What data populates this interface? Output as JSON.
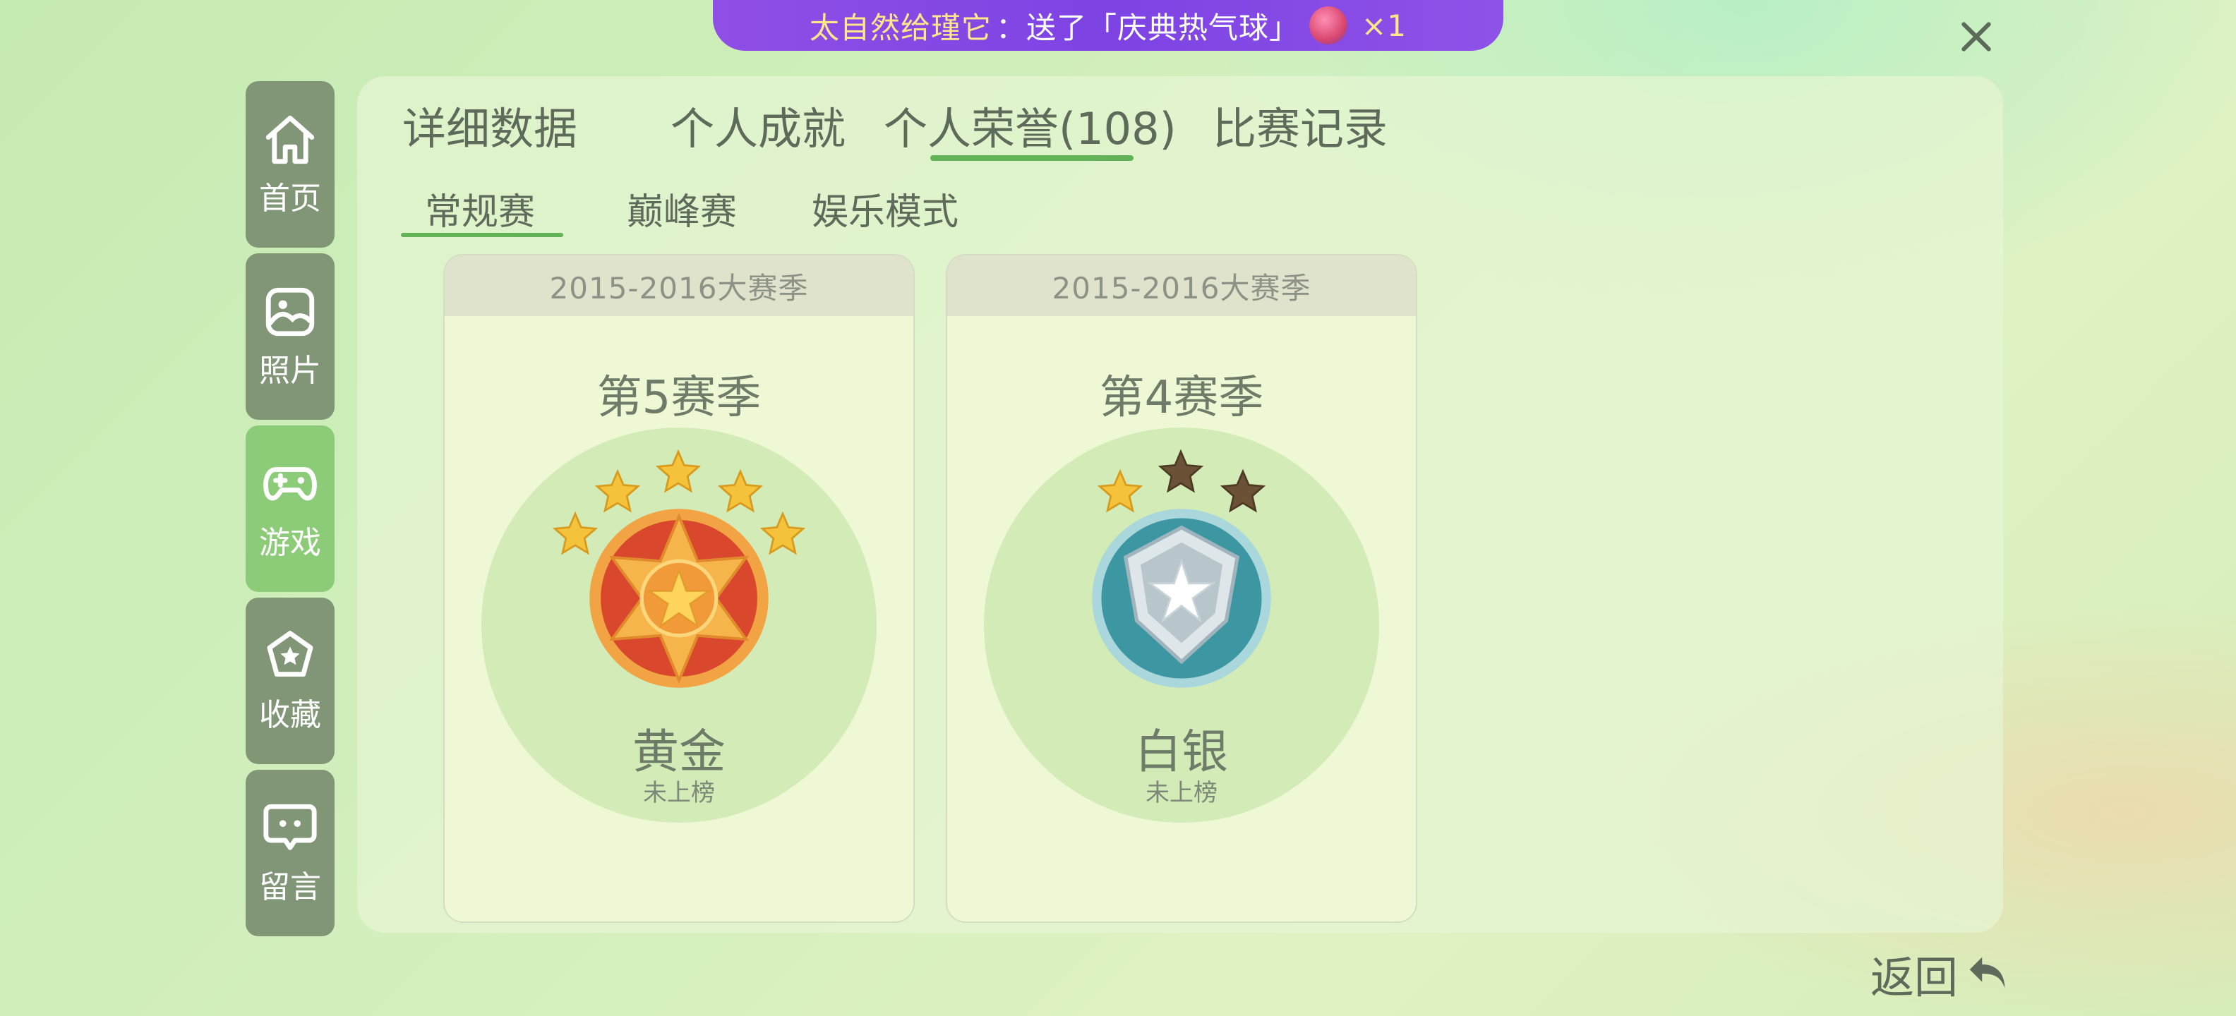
{
  "banner": {
    "user": "太自然给瑾它",
    "gift_text": "：送了「庆典热气球」",
    "count": "×1"
  },
  "sidebar": {
    "items": [
      {
        "label": "首页",
        "icon": "home-icon"
      },
      {
        "label": "照片",
        "icon": "photo-icon"
      },
      {
        "label": "游戏",
        "icon": "gamepad-icon"
      },
      {
        "label": "收藏",
        "icon": "star-collection-icon"
      },
      {
        "label": "留言",
        "icon": "message-icon"
      }
    ],
    "active": "游戏"
  },
  "tabs": {
    "detail": "详细数据",
    "achievements": "个人成就",
    "honors": "个人荣誉(108)",
    "records": "比赛记录",
    "active": "个人荣誉(108)"
  },
  "subtabs": {
    "regular": "常规赛",
    "peak": "巅峰赛",
    "casual": "娱乐模式",
    "active": "常规赛"
  },
  "cards": [
    {
      "season_range": "2015-2016大赛季",
      "season": "第5赛季",
      "rank": "黄金",
      "status": "未上榜",
      "stars_filled": 5,
      "stars_total": 5
    },
    {
      "season_range": "2015-2016大赛季",
      "season": "第4赛季",
      "rank": "白银",
      "status": "未上榜",
      "stars_filled": 1,
      "stars_total": 3
    }
  ],
  "back": {
    "label": "返回"
  },
  "colors": {
    "accent_green": "#62b258",
    "banner_purple": "#7d43e3",
    "gold_star": "#f5c23c",
    "empty_star": "#6b5236"
  }
}
